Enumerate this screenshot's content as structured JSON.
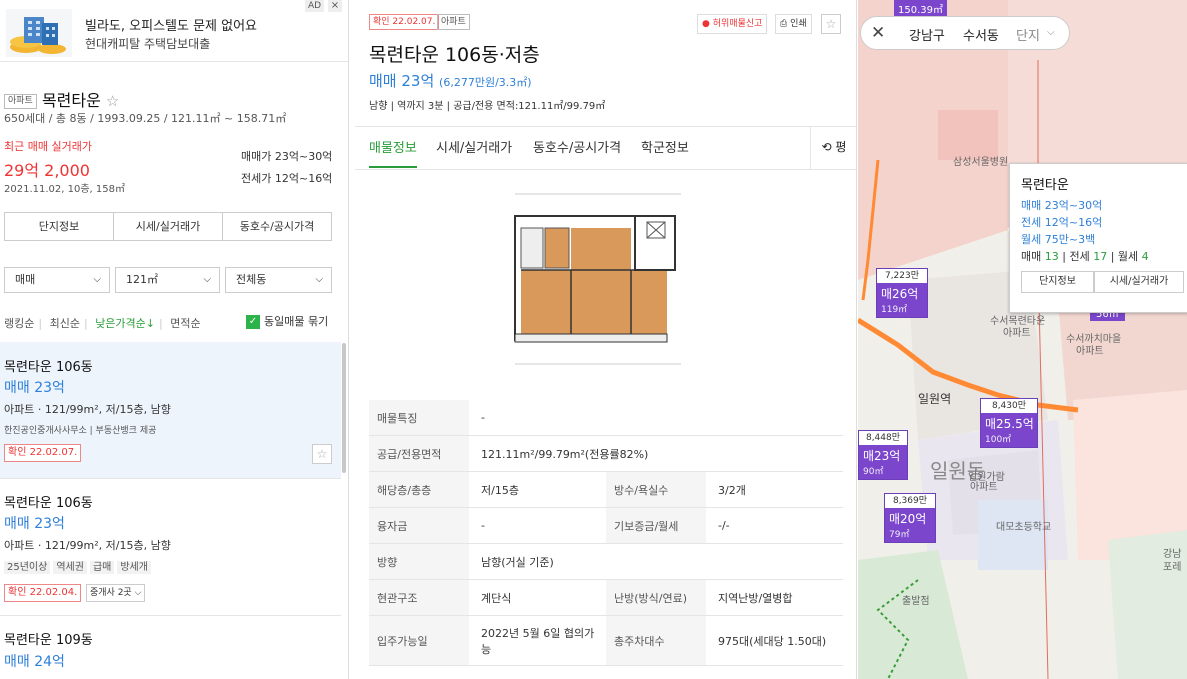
{
  "ad": {
    "tag": "AD",
    "close": "×",
    "title": "빌라도, 오피스텔도 문제 없어요",
    "subtitle": "현대캐피탈 주택담보대출"
  },
  "complex": {
    "badge": "아파트",
    "name": "목련타운",
    "star": "☆",
    "meta": "650세대 / 총 8동 / 1993.09.25 / 121.11㎡ ~ 158.71㎡",
    "recent_label": "최근 매매 실거래가",
    "recent_price": "29억 2,000",
    "recent_date": "2021.11.02, 10층, 158㎡",
    "sale_range": "매매가 23억~30억",
    "lease_range": "전세가 12억~16억",
    "tabs": [
      "단지정보",
      "시세/실거래가",
      "동호수/공시가격"
    ]
  },
  "filters": {
    "trade": "매매",
    "area": "121㎡",
    "dong": "전체동"
  },
  "sort": {
    "options": [
      "랭킹순",
      "최신순",
      "낮은가격순↓",
      "면적순"
    ],
    "same_label": "동일매물 묶기"
  },
  "listings": [
    {
      "title": "목련타운 106동",
      "price": "매매 23억",
      "spec": "아파트 · 121/99m², 저/15층, 남향",
      "agent": "한진공인중개사사무소 | 부동산뱅크 제공",
      "confirm": "확인 22.02.07."
    },
    {
      "title": "목련타운 106동",
      "price": "매매 23억",
      "spec": "아파트 · 121/99m², 저/15층, 남향",
      "tags": [
        "25년이상",
        "역세권",
        "급매",
        "방세개"
      ],
      "confirm": "확인 22.02.04.",
      "agents": "중개사 2곳"
    },
    {
      "title": "목련타운 109동",
      "price": "매매 24억"
    }
  ],
  "detail": {
    "confirm": "확인 22.02.07.",
    "type": "아파트",
    "report": "허위매물신고",
    "print": "인쇄",
    "title": "목련타운 106동·저층",
    "price": "매매 23억",
    "price_unit": "(6,277만원/3.3㎡)",
    "info": "남향 | 역까지 3분 | 공급/전용 면적:121.11㎡/99.79㎡",
    "tabs": [
      "매물정보",
      "시세/실거래가",
      "동호수/공시가격",
      "학군정보"
    ],
    "pyeong": "평",
    "rows": [
      {
        "h": "매물특징",
        "v": "-"
      },
      {
        "h": "공급/전용면적",
        "v": "121.11m²/99.79m²(전용률82%)"
      },
      {
        "h": "해당층/총층",
        "v": "저/15층",
        "h2": "방수/욕실수",
        "v2": "3/2개"
      },
      {
        "h": "융자금",
        "v": "-",
        "h2": "기보증금/월세",
        "v2": "-/-"
      },
      {
        "h": "방향",
        "v": "남향(거실 기준)"
      },
      {
        "h": "현관구조",
        "v": "계단식",
        "h2": "난방(방식/연료)",
        "v2": "지역난방/열병합"
      },
      {
        "h": "입주가능일",
        "v": "2022년 5월 6일 협의가능",
        "h2": "총주차대수",
        "v2": "975대(세대당 1.50대)"
      }
    ]
  },
  "map": {
    "search": [
      "강남구",
      "수서동",
      "단지"
    ],
    "callout": {
      "title": "목련타운",
      "sale": "매매 23억~30억",
      "lease": "전세 12억~16억",
      "monthly": "월세 75만~3백",
      "counts_sale": "매매",
      "sale_n": "13",
      "counts_lease": "전세",
      "lease_n": "17",
      "counts_monthly": "월세",
      "monthly_n": "4",
      "btn1": "단지정보",
      "btn2": "시세/실거래가"
    },
    "pins": [
      {
        "top": "7,223만",
        "price": "매26억",
        "area": "119㎡"
      },
      {
        "top": "8,430만",
        "price": "매25.5억",
        "area": "100㎡"
      },
      {
        "top": "8,448만",
        "price": "매23억",
        "area": "90㎡"
      },
      {
        "top": "8,369만",
        "price": "매20억",
        "area": "79㎡"
      }
    ],
    "labels": {
      "hospital": "삼성서울병원",
      "apt1": "수서목련타운",
      "apt1b": "아파트",
      "apt2": "수서까치마을",
      "apt2b": "아파트",
      "station": "일원역",
      "district": "일원동",
      "apt3": "일원가람",
      "apt3b": "아파트",
      "school": "대모초등학교",
      "bus": "출발점",
      "top_pin": "150.39㎡",
      "gangnam": "강남",
      "forest": "포레",
      "pin_area2": "56㎡"
    }
  }
}
